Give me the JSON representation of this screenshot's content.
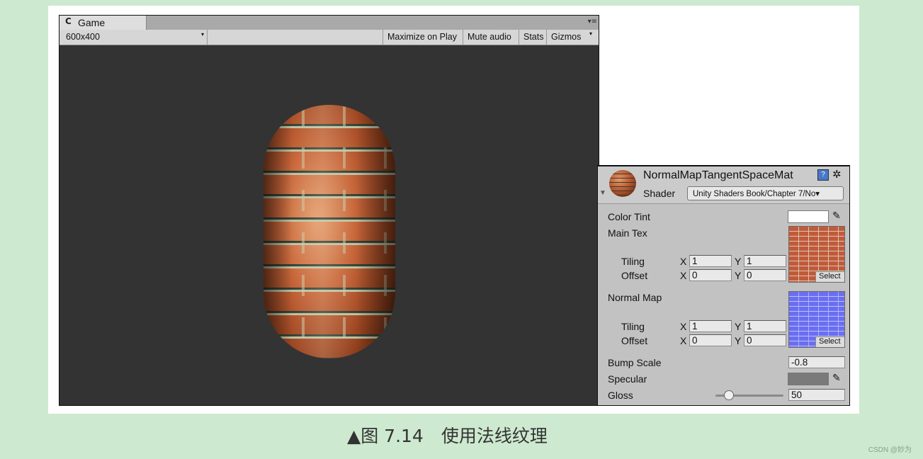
{
  "game_window": {
    "tab_icon": "C",
    "tab_label": "Game",
    "menu_icon": "▾≡",
    "resolution": "600x400",
    "resolution_arrow": "▾",
    "buttons": {
      "maximize": "Maximize on Play",
      "mute": "Mute audio",
      "stats": "Stats",
      "gizmos": "Gizmos",
      "gizmos_arrow": "▾"
    }
  },
  "inspector": {
    "material_name": "NormalMapTangentSpaceMat",
    "help_icon": "?",
    "gear_icon": "✲",
    "fold_arrow": "▼",
    "shader_label": "Shader",
    "shader_value": "Unity Shaders Book/Chapter 7/No▾",
    "color_tint_label": "Color Tint",
    "color_tint": "#ffffff",
    "main_tex_label": "Main Tex",
    "main_tex": {
      "tiling_label": "Tiling",
      "offset_label": "Offset",
      "x_label": "X",
      "y_label": "Y",
      "tiling_x": "1",
      "tiling_y": "1",
      "offset_x": "0",
      "offset_y": "0",
      "select": "Select"
    },
    "normal_map_label": "Normal Map",
    "normal_map": {
      "tiling_label": "Tiling",
      "offset_label": "Offset",
      "x_label": "X",
      "y_label": "Y",
      "tiling_x": "1",
      "tiling_y": "1",
      "offset_x": "0",
      "offset_y": "0",
      "select": "Select"
    },
    "bump_scale_label": "Bump Scale",
    "bump_scale": "-0.8",
    "specular_label": "Specular",
    "specular_color": "#7a7a7a",
    "gloss_label": "Gloss",
    "gloss": "50",
    "picker_icon": "✎"
  },
  "caption": "▲图 7.14　使用法线纹理",
  "watermark": "CSDN @妙为"
}
